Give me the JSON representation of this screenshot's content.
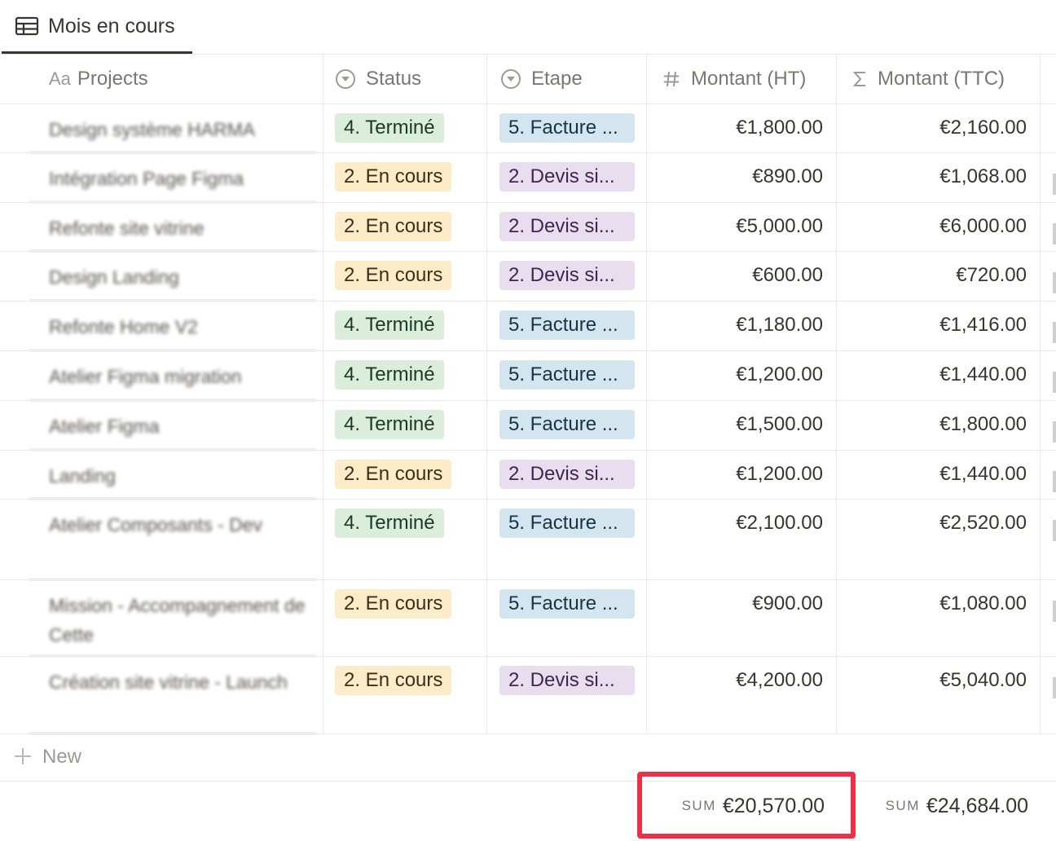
{
  "view_tab": {
    "label": "Mois en cours",
    "icon": "table-icon"
  },
  "columns": {
    "projects": "Projects",
    "projects_prefix": "Aa",
    "status": "Status",
    "etape": "Etape",
    "montant_ht": "Montant (HT)",
    "montant_ttc": "Montant (TTC)"
  },
  "rows": [
    {
      "project": "Design système HARMA",
      "status": "4. Terminé",
      "etape": "5. Facture ...",
      "ht": "€1,800.00",
      "ttc": "€2,160.00"
    },
    {
      "project": "Intégration Page Figma",
      "status": "2. En cours",
      "etape": "2. Devis si...",
      "ht": "€890.00",
      "ttc": "€1,068.00"
    },
    {
      "project": "Refonte site vitrine",
      "status": "2. En cours",
      "etape": "2. Devis si...",
      "ht": "€5,000.00",
      "ttc": "€6,000.00"
    },
    {
      "project": "Design Landing",
      "status": "2. En cours",
      "etape": "2. Devis si...",
      "ht": "€600.00",
      "ttc": "€720.00"
    },
    {
      "project": "Refonte Home V2",
      "status": "4. Terminé",
      "etape": "5. Facture ...",
      "ht": "€1,180.00",
      "ttc": "€1,416.00"
    },
    {
      "project": "Atelier Figma migration",
      "status": "4. Terminé",
      "etape": "5. Facture ...",
      "ht": "€1,200.00",
      "ttc": "€1,440.00"
    },
    {
      "project": "Atelier Figma",
      "status": "4. Terminé",
      "etape": "5. Facture ...",
      "ht": "€1,500.00",
      "ttc": "€1,800.00"
    },
    {
      "project": "Landing",
      "status": "2. En cours",
      "etape": "2. Devis si...",
      "ht": "€1,200.00",
      "ttc": "€1,440.00"
    },
    {
      "project": "Atelier Composants - Dev",
      "status": "4. Terminé",
      "etape": "5. Facture ...",
      "ht": "€2,100.00",
      "ttc": "€2,520.00"
    },
    {
      "project": "Mission - Accompagnement de Cette",
      "status": "2. En cours",
      "etape": "5. Facture ...",
      "ht": "€900.00",
      "ttc": "€1,080.00"
    },
    {
      "project": "Création site vitrine - Launch",
      "status": "2. En cours",
      "etape": "2. Devis si...",
      "ht": "€4,200.00",
      "ttc": "€5,040.00"
    }
  ],
  "new_row": {
    "label": "New"
  },
  "sums": {
    "tag": "SUM",
    "ht": "€20,570.00",
    "ttc": "€24,684.00"
  },
  "colors": {
    "highlight": "#ee2f47",
    "pill_green": "#dbeddb",
    "pill_yellow": "#fdecc8",
    "pill_blue": "#d3e5ef",
    "pill_purple": "#e8deee"
  }
}
